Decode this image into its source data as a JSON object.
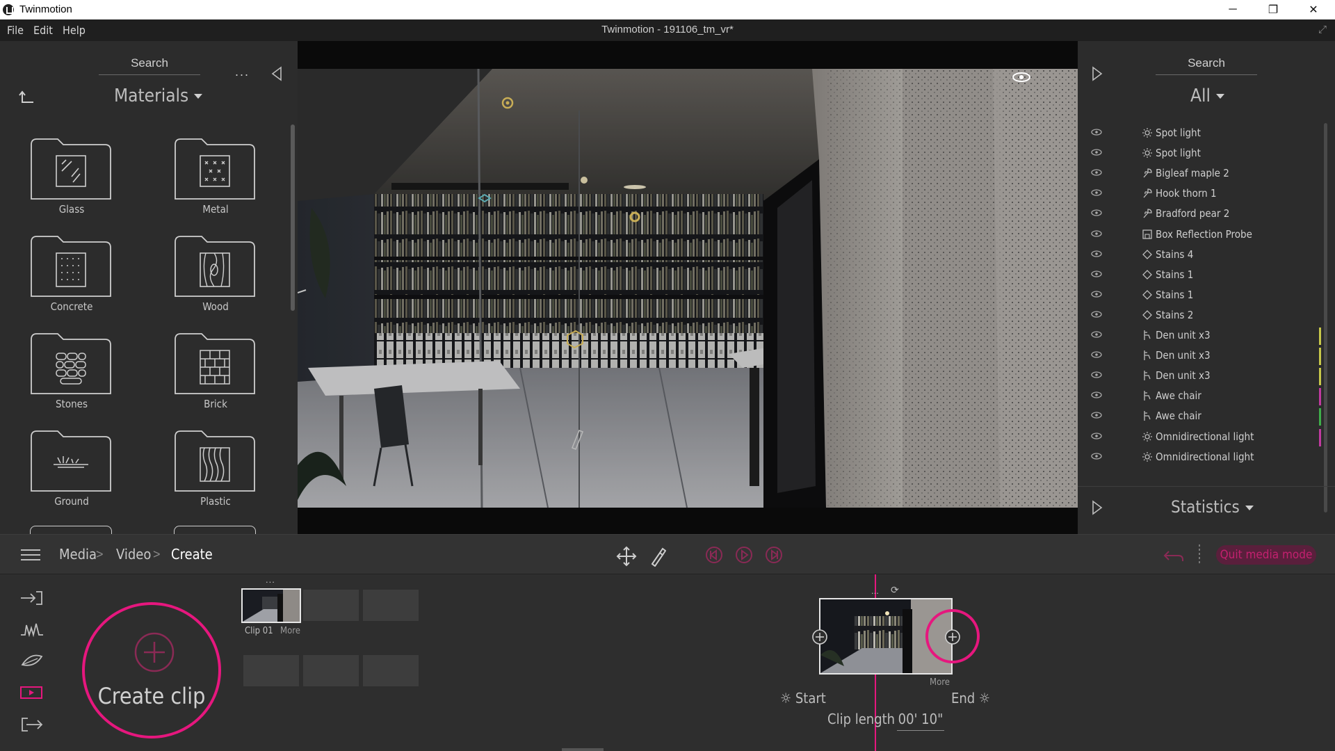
{
  "window": {
    "app_title": "Twinmotion",
    "doc_title": "Twinmotion - 191106_tm_vr*",
    "controls": {
      "minimize": "─",
      "restore": "❐",
      "close": "✕"
    }
  },
  "menu": {
    "file": "File",
    "edit": "Edit",
    "help": "Help"
  },
  "left_panel": {
    "search_label": "Search",
    "more": "...",
    "category": "Materials",
    "materials": [
      {
        "label": "Glass",
        "icon": "glass-icon"
      },
      {
        "label": "Metal",
        "icon": "metal-icon"
      },
      {
        "label": "Concrete",
        "icon": "concrete-icon"
      },
      {
        "label": "Wood",
        "icon": "wood-icon"
      },
      {
        "label": "Stones",
        "icon": "stones-icon"
      },
      {
        "label": "Brick",
        "icon": "brick-icon"
      },
      {
        "label": "Ground",
        "icon": "ground-icon"
      },
      {
        "label": "Plastic",
        "icon": "plastic-icon"
      }
    ]
  },
  "right_panel": {
    "search_label": "Search",
    "filter": "All",
    "items": [
      {
        "label": "Spot light",
        "icon": "light"
      },
      {
        "label": "Spot light",
        "icon": "light"
      },
      {
        "label": "Bigleaf maple 2",
        "icon": "tree"
      },
      {
        "label": "Hook thorn 1",
        "icon": "tree"
      },
      {
        "label": "Bradford pear 2",
        "icon": "tree"
      },
      {
        "label": "Box Reflection Probe",
        "icon": "probe"
      },
      {
        "label": "Stains 4",
        "icon": "decal"
      },
      {
        "label": "Stains 1",
        "icon": "decal"
      },
      {
        "label": "Stains 1",
        "icon": "decal"
      },
      {
        "label": "Stains 2",
        "icon": "decal"
      },
      {
        "label": "Den unit x3",
        "icon": "object",
        "tag": "#c8c84a"
      },
      {
        "label": "Den unit x3",
        "icon": "object",
        "tag": "#c8c84a"
      },
      {
        "label": "Den unit x3",
        "icon": "object",
        "tag": "#c8c84a"
      },
      {
        "label": "Awe chair",
        "icon": "object",
        "tag": "#c03aa0"
      },
      {
        "label": "Awe chair",
        "icon": "object",
        "tag": "#3fae4a"
      },
      {
        "label": "Omnidirectional light",
        "icon": "light",
        "tag": "#c03aa0"
      },
      {
        "label": "Omnidirectional light",
        "icon": "light"
      }
    ],
    "statistics": "Statistics"
  },
  "bottom_bar": {
    "crumbs": [
      "Media",
      "Video",
      "Create"
    ],
    "quit_label": "Quit media mode",
    "accent": "#e6177e"
  },
  "workspace": {
    "create_clip": "Create clip",
    "clip_name": "Clip 01",
    "more": "More",
    "dots": "...",
    "start": "Start",
    "end": "End",
    "clip_length_label": "Clip length",
    "clip_length_value": "00' 10\""
  }
}
